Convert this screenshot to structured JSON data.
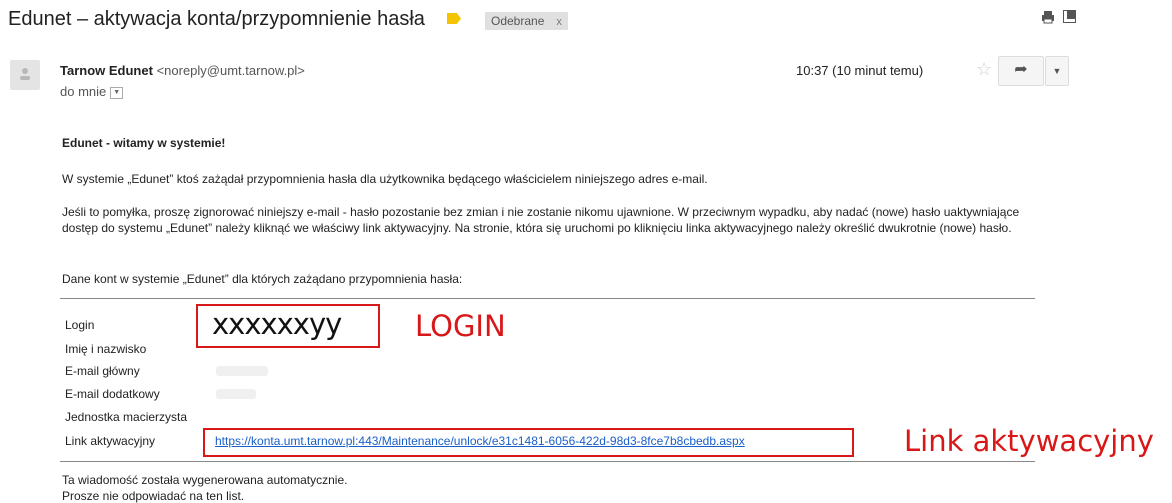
{
  "email": {
    "subject": "Edunet – aktywacja konta/przypomnienie hasła",
    "label_chip": "Odebrane",
    "label_chip_close": "x",
    "sender_name": "Tarnow Edunet",
    "sender_address": "<noreply@umt.tarnow.pl>",
    "recipient": "do mnie",
    "time": "10:37 (10 minut temu)"
  },
  "body": {
    "greeting": "Edunet - witamy w systemie!",
    "paragraph1": "W systemie „Edunet” ktoś zażądał przypomnienia hasła dla użytkownika będącego właścicielem niniejszego adres e-mail.",
    "paragraph2": "Jeśli to pomyłka, proszę zignorować niniejszy e-mail - hasło pozostanie bez zmian i nie zostanie nikomu ujawnione. W przeciwnym wypadku, aby nadać (nowe) hasło uaktywniające dostęp do systemu „Edunet” należy kliknąć we właściwy link aktywacyjny. Na stronie, która się uruchomi po kliknięciu linka aktywacyjnego należy określić dwukrotnie (nowe) hasło.",
    "paragraph3": "Dane kont w systemie „Edunet” dla których zażądano przypomnienia hasła:"
  },
  "account_table": {
    "rows": [
      {
        "label": "Login",
        "value": "xxxxxxyy"
      },
      {
        "label": "Imię i nazwisko",
        "value": ""
      },
      {
        "label": "E-mail główny",
        "value": ""
      },
      {
        "label": "E-mail dodatkowy",
        "value": ""
      },
      {
        "label": "Jednostka macierzysta",
        "value": ""
      },
      {
        "label": "Link aktywacyjny",
        "value": "https://konta.umt.tarnow.pl:443/Maintenance/unlock/e31c1481-6056-422d-98d3-8fce7b8cbedb.aspx"
      }
    ]
  },
  "annotations": {
    "login": "LOGIN",
    "link": "Link aktywacyjny",
    "color": "#d81818"
  },
  "footer": {
    "line1": "Ta wiadomość została wygenerowana automatycznie.",
    "line2": "Prosze nie odpowiadać na ten list."
  },
  "icons": {
    "label": "label-tag-icon",
    "print": "print-icon",
    "new_window": "new-window-icon",
    "star": "star-icon",
    "reply": "reply-icon",
    "more": "chevron-down-icon",
    "avatar": "person-icon"
  }
}
